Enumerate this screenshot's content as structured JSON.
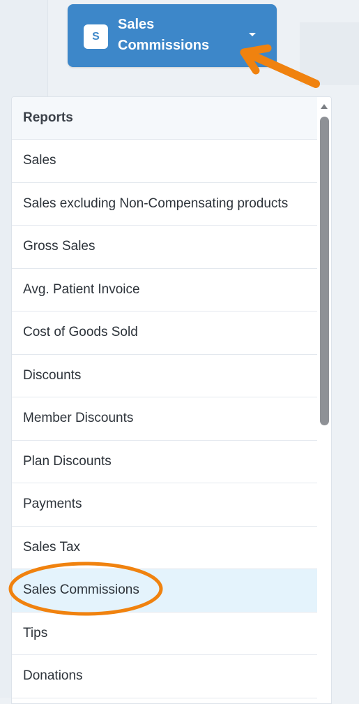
{
  "selector": {
    "badge": "S",
    "title": "Sales Commissions"
  },
  "dropdown": {
    "header": "Reports",
    "items": [
      "Sales",
      "Sales excluding Non-Compensating products",
      "Gross Sales",
      "Avg. Patient Invoice",
      "Cost of Goods Sold",
      "Discounts",
      "Member Discounts",
      "Plan Discounts",
      "Payments",
      "Sales Tax",
      "Sales Commissions",
      "Tips",
      "Donations"
    ],
    "selected_item": "Sales Commissions"
  },
  "colors": {
    "selector_bg": "#3d87c9",
    "selected_row_bg": "#e4f3fc",
    "annotation_orange": "#f0820f"
  },
  "icons": {
    "dropdown": "chevron-down-icon",
    "scroll_up": "scroll-up-icon",
    "callout_arrow": "arrow-annotation-icon",
    "highlight": "circle-highlight-annotation"
  }
}
